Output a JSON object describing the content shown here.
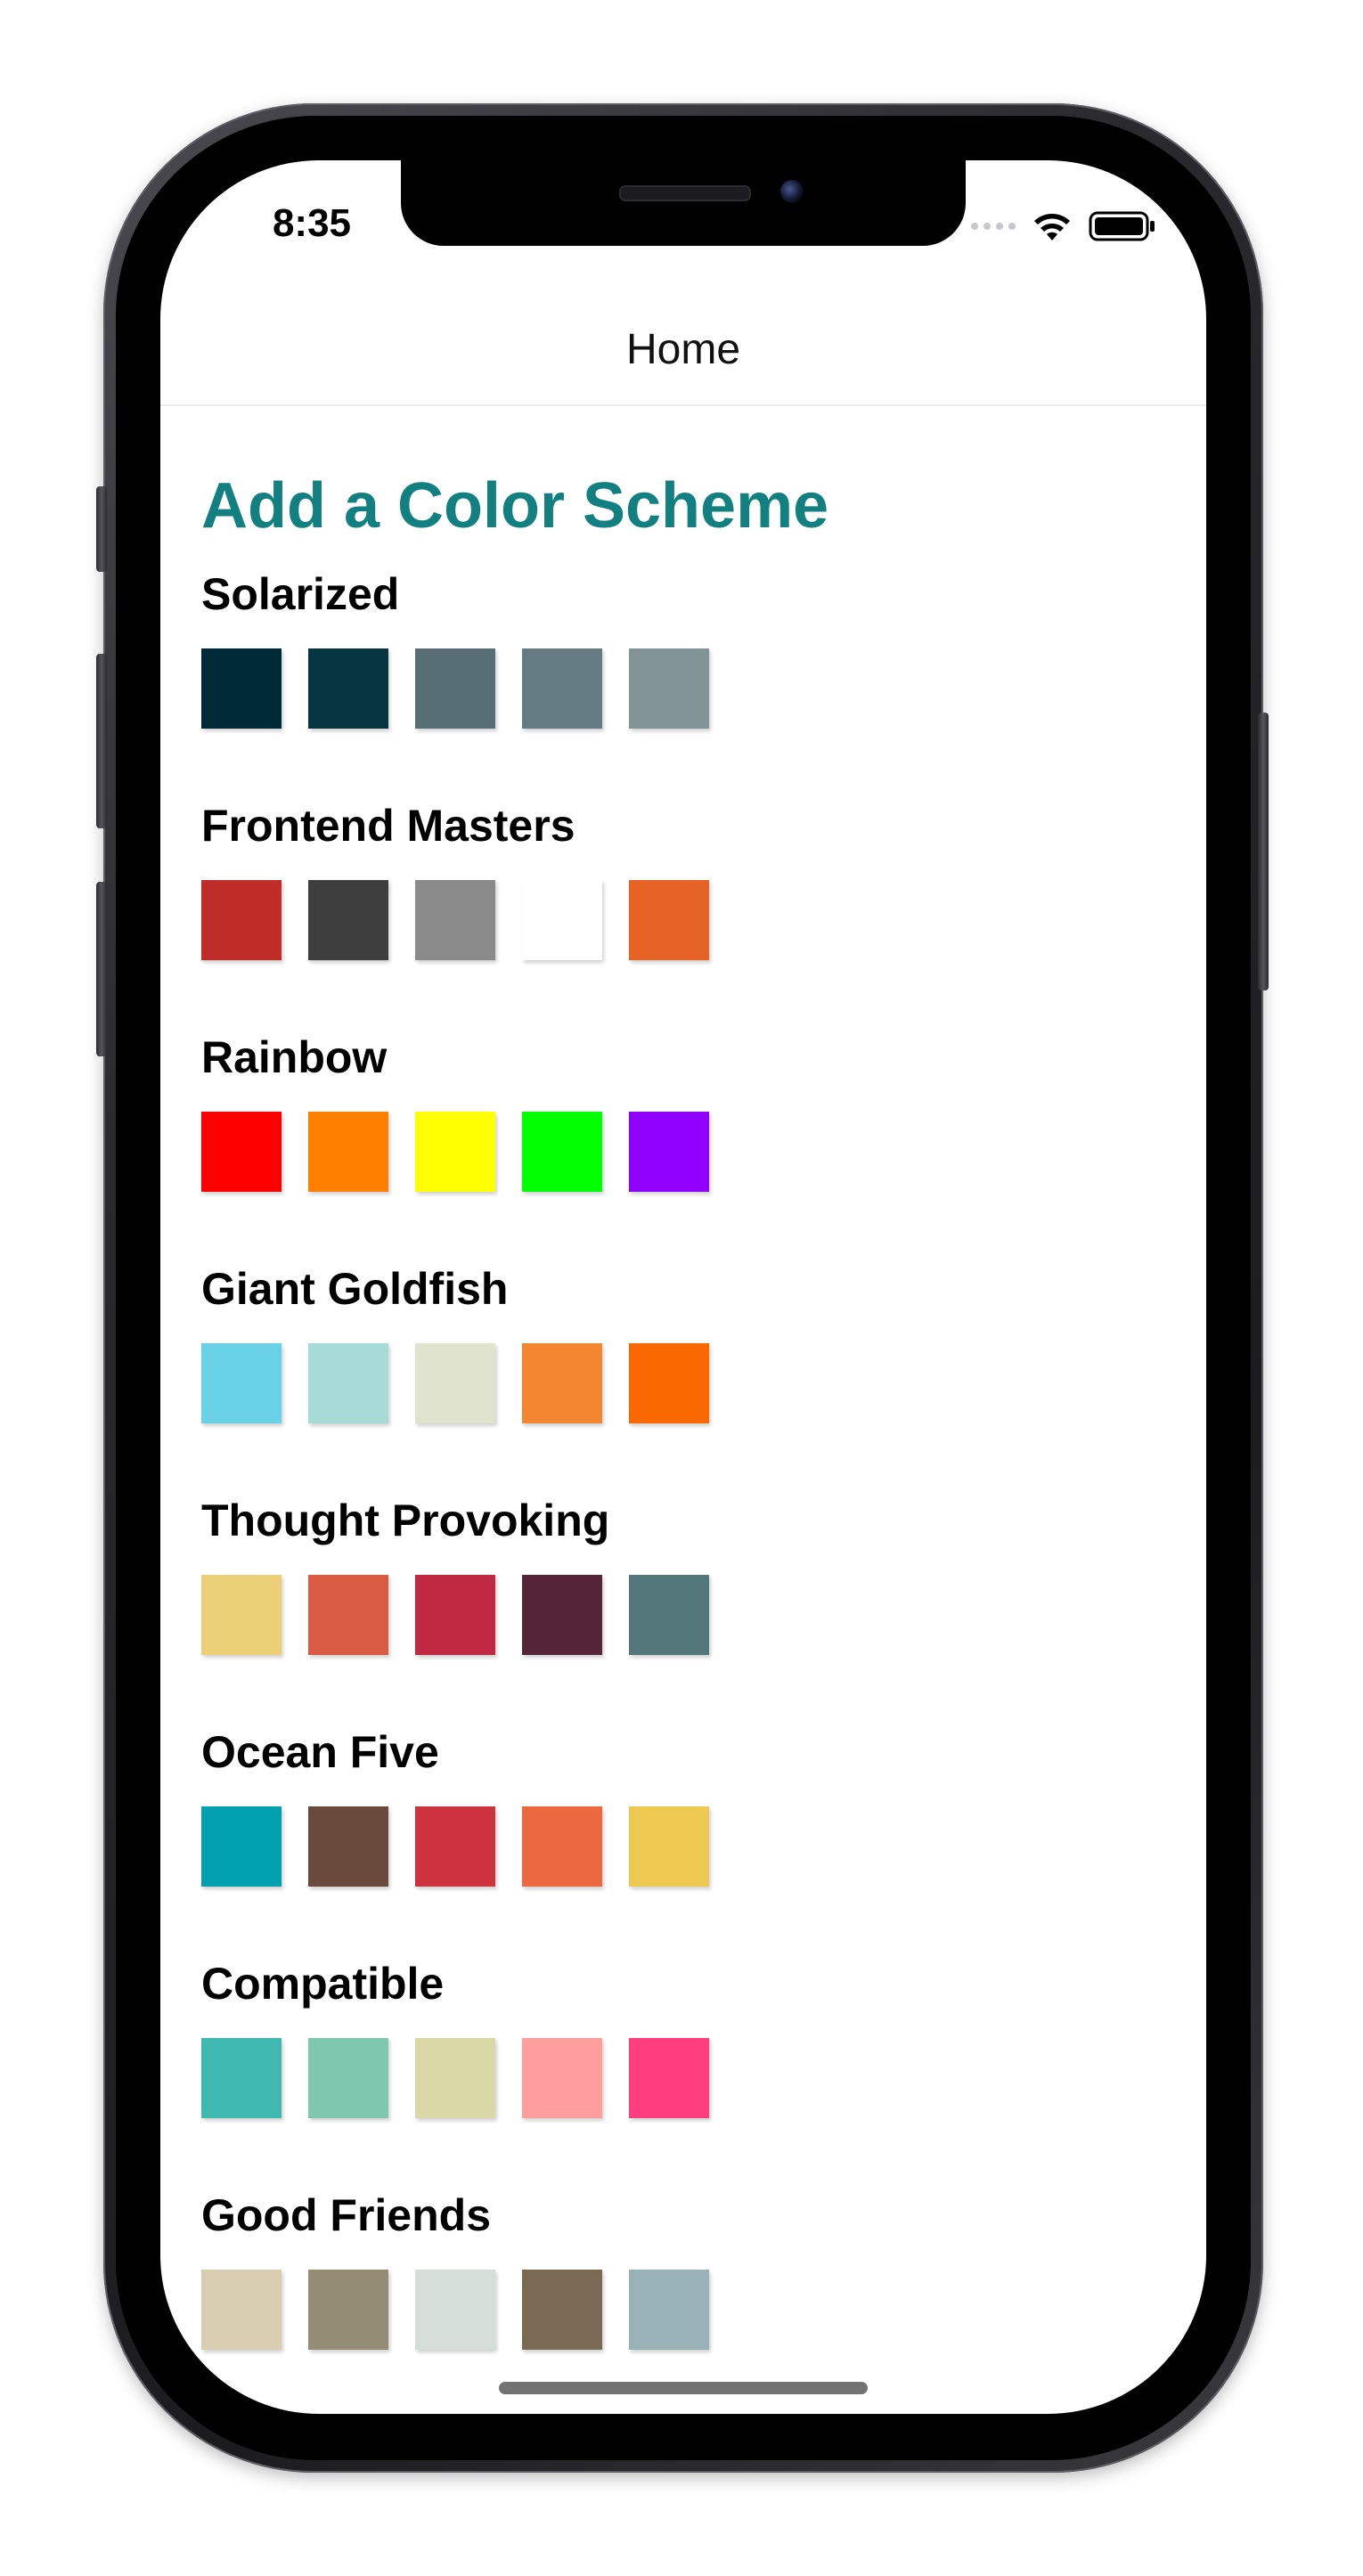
{
  "status_bar": {
    "time": "8:35",
    "icons": [
      "cellular-signal-icon",
      "wifi-icon",
      "battery-icon"
    ]
  },
  "nav": {
    "title": "Home"
  },
  "page": {
    "heading": "Add a Color Scheme",
    "heading_color": "#127f80"
  },
  "schemes": [
    {
      "name": "Solarized",
      "colors": [
        "#002b36",
        "#073642",
        "#586e75",
        "#657b83",
        "#839496"
      ]
    },
    {
      "name": "Frontend Masters",
      "colors": [
        "#c02d28",
        "#3e3e3e",
        "#8a8a8a",
        "#ffffff",
        "#e66225"
      ]
    },
    {
      "name": "Rainbow",
      "colors": [
        "#ff0000",
        "#ff8000",
        "#ffff00",
        "#00ff00",
        "#8f00ff"
      ]
    },
    {
      "name": "Giant Goldfish",
      "colors": [
        "#69d2e7",
        "#a7dbd8",
        "#e0e4cc",
        "#f38630",
        "#fa6900"
      ]
    },
    {
      "name": "Thought Provoking",
      "colors": [
        "#ecd078",
        "#d95b43",
        "#c02942",
        "#542437",
        "#53777a"
      ]
    },
    {
      "name": "Ocean Five",
      "colors": [
        "#00a0b0",
        "#6a4a3c",
        "#cc333f",
        "#eb6841",
        "#edc951"
      ]
    },
    {
      "name": "Compatible",
      "colors": [
        "#3fb8af",
        "#7fc7af",
        "#dad8a7",
        "#ff9e9d",
        "#ff3d7f"
      ]
    },
    {
      "name": "Good Friends",
      "colors": [
        "#d9ceb2",
        "#948c75",
        "#d5ded9",
        "#7a6a53",
        "#99b2b7"
      ]
    }
  ]
}
